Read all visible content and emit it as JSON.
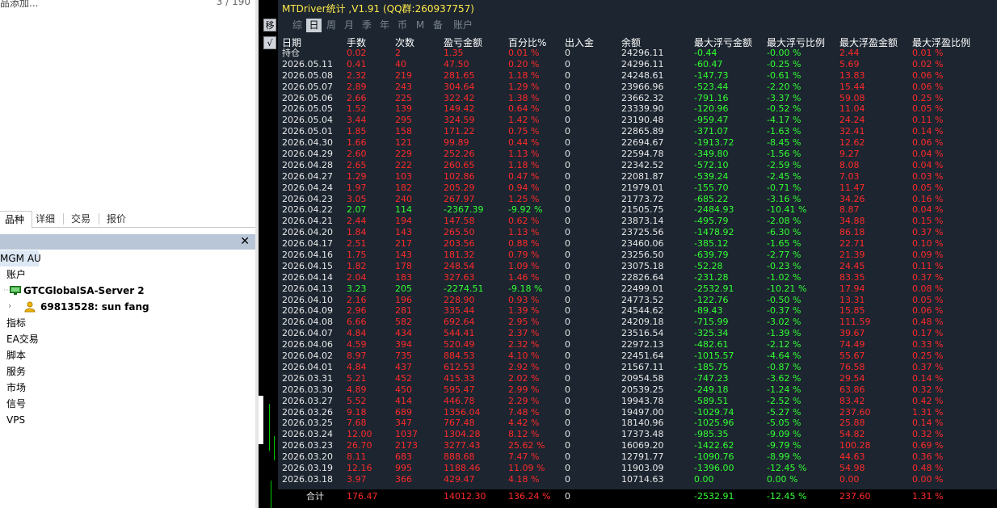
{
  "navigator": {
    "status_left": "品添加...",
    "status_right": "3 / 190",
    "tabs": [
      "品种",
      "详细",
      "交易",
      "报价"
    ],
    "close_glyph": "✕",
    "tree": {
      "symbol": "MGM AU",
      "accounts": "账户",
      "server": "GTCGlobalSA-Server 2",
      "user": "69813528: sun fang",
      "indicators": "指标",
      "ea": "EA交易",
      "scripts": "脚本",
      "services": "服务",
      "market": "市场",
      "signals": "信号",
      "vps": "VPS"
    }
  },
  "stats": {
    "title": "MTDriver统计 ,V1.91 (QQ群:260937757)",
    "filters": [
      "综",
      "日",
      "周",
      "月",
      "季",
      "年",
      "币",
      "M",
      "备",
      "账户"
    ],
    "active_filter": "日",
    "side_buttons": [
      "移",
      "√"
    ],
    "columns": [
      "日期",
      "手数",
      "次数",
      "盈亏金额",
      "百分比%",
      "出入金",
      "余额",
      "最大浮亏金额",
      "最大浮亏比例",
      "最大浮盈金额",
      "最大浮盈比例"
    ],
    "colors": {
      "profit": "#ff2a2a",
      "loss": "#33ff33",
      "title": "#ffe94a",
      "panel_bg": "#1c2530"
    },
    "rows": [
      [
        "持仓",
        "0.02",
        "2",
        "1.35",
        "0.01 %",
        "0",
        "24296.11",
        "-0.44",
        "-0.00 %",
        "2.44",
        "0.01 %"
      ],
      [
        "2026.05.11",
        "0.41",
        "40",
        "47.50",
        "0.20 %",
        "0",
        "24296.11",
        "-60.47",
        "-0.25 %",
        "5.69",
        "0.02 %"
      ],
      [
        "2026.05.08",
        "2.32",
        "219",
        "281.65",
        "1.18 %",
        "0",
        "24248.61",
        "-147.73",
        "-0.61 %",
        "13.83",
        "0.06 %"
      ],
      [
        "2026.05.07",
        "2.89",
        "243",
        "304.64",
        "1.29 %",
        "0",
        "23966.96",
        "-523.44",
        "-2.20 %",
        "15.44",
        "0.06 %"
      ],
      [
        "2026.05.06",
        "2.66",
        "225",
        "322.42",
        "1.38 %",
        "0",
        "23662.32",
        "-791.16",
        "-3.37 %",
        "59.08",
        "0.25 %"
      ],
      [
        "2026.05.05",
        "1.52",
        "139",
        "149.42",
        "0.64 %",
        "0",
        "23339.90",
        "-120.96",
        "-0.52 %",
        "11.04",
        "0.05 %"
      ],
      [
        "2026.05.04",
        "3.44",
        "295",
        "324.59",
        "1.42 %",
        "0",
        "23190.48",
        "-959.47",
        "-4.17 %",
        "24.24",
        "0.11 %"
      ],
      [
        "2026.05.01",
        "1.85",
        "158",
        "171.22",
        "0.75 %",
        "0",
        "22865.89",
        "-371.07",
        "-1.63 %",
        "32.41",
        "0.14 %"
      ],
      [
        "2026.04.30",
        "1.66",
        "121",
        "99.89",
        "0.44 %",
        "0",
        "22694.67",
        "-1913.72",
        "-8.45 %",
        "12.62",
        "0.06 %"
      ],
      [
        "2026.04.29",
        "2.60",
        "229",
        "252.26",
        "1.13 %",
        "0",
        "22594.78",
        "-349.80",
        "-1.56 %",
        "9.27",
        "0.04 %"
      ],
      [
        "2026.04.28",
        "2.65",
        "222",
        "260.65",
        "1.18 %",
        "0",
        "22342.52",
        "-572.10",
        "-2.59 %",
        "8.08",
        "0.04 %"
      ],
      [
        "2026.04.27",
        "1.29",
        "103",
        "102.86",
        "0.47 %",
        "0",
        "22081.87",
        "-539.24",
        "-2.45 %",
        "7.03",
        "0.03 %"
      ],
      [
        "2026.04.24",
        "1.97",
        "182",
        "205.29",
        "0.94 %",
        "0",
        "21979.01",
        "-155.70",
        "-0.71 %",
        "11.47",
        "0.05 %"
      ],
      [
        "2026.04.23",
        "3.05",
        "240",
        "267.97",
        "1.25 %",
        "0",
        "21773.72",
        "-685.22",
        "-3.16 %",
        "34.26",
        "0.16 %"
      ],
      [
        "2026.04.22",
        "2.07",
        "114",
        "-2367.39",
        "-9.92 %",
        "0",
        "21505.75",
        "-2484.93",
        "-10.41 %",
        "8.87",
        "0.04 %"
      ],
      [
        "2026.04.21",
        "2.44",
        "194",
        "147.58",
        "0.62 %",
        "0",
        "23873.14",
        "-495.79",
        "-2.08 %",
        "34.88",
        "0.15 %"
      ],
      [
        "2026.04.20",
        "1.84",
        "143",
        "265.50",
        "1.13 %",
        "0",
        "23725.56",
        "-1478.92",
        "-6.30 %",
        "86.18",
        "0.37 %"
      ],
      [
        "2026.04.17",
        "2.51",
        "217",
        "203.56",
        "0.88 %",
        "0",
        "23460.06",
        "-385.12",
        "-1.65 %",
        "22.71",
        "0.10 %"
      ],
      [
        "2026.04.16",
        "1.75",
        "143",
        "181.32",
        "0.79 %",
        "0",
        "23256.50",
        "-639.79",
        "-2.77 %",
        "21.39",
        "0.09 %"
      ],
      [
        "2026.04.15",
        "1.82",
        "178",
        "248.54",
        "1.09 %",
        "0",
        "23075.18",
        "-52.28",
        "-0.23 %",
        "24.45",
        "0.11 %"
      ],
      [
        "2026.04.14",
        "2.04",
        "183",
        "327.63",
        "1.46 %",
        "0",
        "22826.64",
        "-231.28",
        "-1.02 %",
        "83.35",
        "0.37 %"
      ],
      [
        "2026.04.13",
        "3.23",
        "205",
        "-2274.51",
        "-9.18 %",
        "0",
        "22499.01",
        "-2532.91",
        "-10.21 %",
        "17.94",
        "0.08 %"
      ],
      [
        "2026.04.10",
        "2.16",
        "196",
        "228.90",
        "0.93 %",
        "0",
        "24773.52",
        "-122.76",
        "-0.50 %",
        "13.31",
        "0.05 %"
      ],
      [
        "2026.04.09",
        "2.96",
        "281",
        "335.44",
        "1.39 %",
        "0",
        "24544.62",
        "-89.43",
        "-0.37 %",
        "15.85",
        "0.06 %"
      ],
      [
        "2026.04.08",
        "6.66",
        "582",
        "692.64",
        "2.95 %",
        "0",
        "24209.18",
        "-715.99",
        "-3.02 %",
        "111.59",
        "0.48 %"
      ],
      [
        "2026.04.07",
        "4.84",
        "434",
        "544.41",
        "2.37 %",
        "0",
        "23516.54",
        "-325.34",
        "-1.39 %",
        "39.67",
        "0.17 %"
      ],
      [
        "2026.04.06",
        "4.59",
        "394",
        "520.49",
        "2.32 %",
        "0",
        "22972.13",
        "-482.61",
        "-2.12 %",
        "74.49",
        "0.33 %"
      ],
      [
        "2026.04.02",
        "8.97",
        "735",
        "884.53",
        "4.10 %",
        "0",
        "22451.64",
        "-1015.57",
        "-4.64 %",
        "55.67",
        "0.25 %"
      ],
      [
        "2026.04.01",
        "4.84",
        "437",
        "612.53",
        "2.92 %",
        "0",
        "21567.11",
        "-185.75",
        "-0.87 %",
        "76.58",
        "0.37 %"
      ],
      [
        "2026.03.31",
        "5.21",
        "452",
        "415.33",
        "2.02 %",
        "0",
        "20954.58",
        "-747.23",
        "-3.62 %",
        "29.54",
        "0.14 %"
      ],
      [
        "2026.03.30",
        "4.89",
        "450",
        "595.47",
        "2.99 %",
        "0",
        "20539.25",
        "-249.18",
        "-1.24 %",
        "63.86",
        "0.32 %"
      ],
      [
        "2026.03.27",
        "5.52",
        "414",
        "446.78",
        "2.29 %",
        "0",
        "19943.78",
        "-589.51",
        "-2.52 %",
        "83.42",
        "0.42 %"
      ],
      [
        "2026.03.26",
        "9.18",
        "689",
        "1356.04",
        "7.48 %",
        "0",
        "19497.00",
        "-1029.74",
        "-5.27 %",
        "237.60",
        "1.31 %"
      ],
      [
        "2026.03.25",
        "7.68",
        "347",
        "767.48",
        "4.42 %",
        "0",
        "18140.96",
        "-1025.96",
        "-5.05 %",
        "25.88",
        "0.14 %"
      ],
      [
        "2026.03.24",
        "12.00",
        "1037",
        "1304.28",
        "8.12 %",
        "0",
        "17373.48",
        "-985.35",
        "-9.09 %",
        "54.82",
        "0.32 %"
      ],
      [
        "2026.03.23",
        "26.70",
        "2173",
        "3277.43",
        "25.62 %",
        "0",
        "16069.20",
        "-1422.62",
        "-9.79 %",
        "100.28",
        "0.69 %"
      ],
      [
        "2026.03.20",
        "8.11",
        "683",
        "888.68",
        "7.47 %",
        "0",
        "12791.77",
        "-1090.76",
        "-8.99 %",
        "44.63",
        "0.36 %"
      ],
      [
        "2026.03.19",
        "12.16",
        "995",
        "1188.46",
        "11.09 %",
        "0",
        "11903.09",
        "-1396.00",
        "-12.45 %",
        "54.98",
        "0.48 %"
      ],
      [
        "2026.03.18",
        "3.97",
        "366",
        "429.47",
        "4.18 %",
        "0",
        "10714.63",
        "0.00",
        "0.00 %",
        "0.00",
        "0.00 %"
      ]
    ],
    "totals": [
      "合计",
      "176.47",
      "",
      "14012.30",
      "136.24 %",
      "0",
      "",
      "-2532.91",
      "-12.45 %",
      "237.60",
      "1.31 %"
    ]
  }
}
